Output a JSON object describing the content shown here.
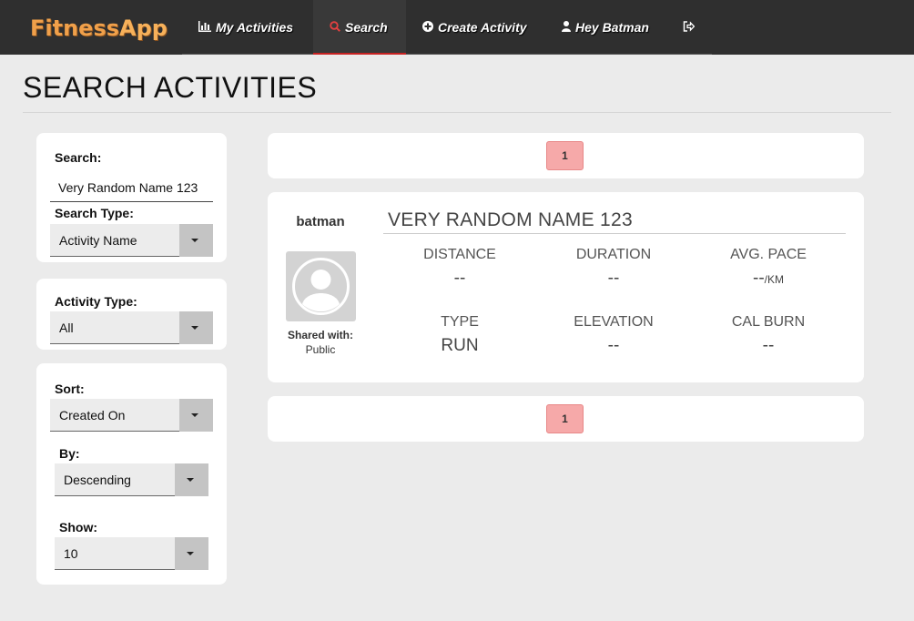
{
  "nav": {
    "brand_fitness": "Fitness",
    "brand_app": "App",
    "activities": "My Activities",
    "search": "Search",
    "create": "Create Activity",
    "user": "Hey Batman"
  },
  "page": {
    "title": "SEARCH ACTIVITIES"
  },
  "filters": {
    "search_label": "Search:",
    "search_value": "Very Random Name 123",
    "search_type_label": "Search Type:",
    "search_type_value": "Activity Name",
    "activity_type_label": "Activity Type:",
    "activity_type_value": "All",
    "sort_label": "Sort:",
    "sort_value": "Created On",
    "by_label": "By:",
    "by_value": "Descending",
    "show_label": "Show:",
    "show_value": "10"
  },
  "pagination": {
    "current_page": "1"
  },
  "result": {
    "username": "batman",
    "shared_label": "Shared with:",
    "shared_value": "Public",
    "title": "VERY RANDOM NAME 123",
    "stats": {
      "distance_label": "DISTANCE",
      "distance_value": "--",
      "duration_label": "DURATION",
      "duration_value": "--",
      "pace_label": "AVG. PACE",
      "pace_value": "--",
      "pace_unit": "/KM",
      "type_label": "TYPE",
      "type_value": "RUN",
      "elevation_label": "ELEVATION",
      "elevation_value": "--",
      "cal_label": "CAL BURN",
      "cal_value": "--"
    }
  },
  "colors": {
    "nav_bg": "#2f2f2f",
    "accent_red": "#c72222",
    "page_btn": "#f6a9a9",
    "brand": "#f0a04a"
  }
}
